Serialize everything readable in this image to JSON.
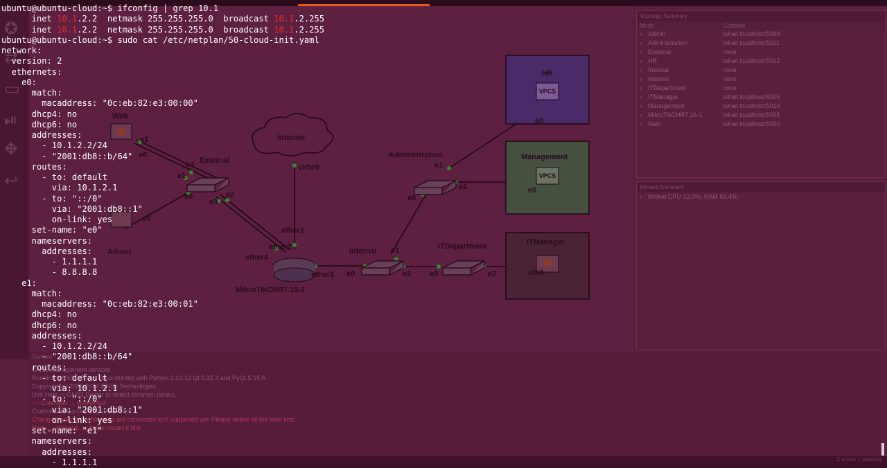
{
  "terminal": {
    "lines": [
      {
        "indent": "",
        "text": "ubuntu@ubuntu-cloud:~$ ifconfig | grep 10.1"
      },
      {
        "indent": "",
        "text": ""
      },
      {
        "indent": "",
        "text": ""
      },
      {
        "indent": "",
        "text": "ubuntu@ubuntu-cloud:~$ sudo cat /etc/netplan/50-cloud-init.yaml"
      },
      {
        "indent": "",
        "text": "network:"
      },
      {
        "indent": "  ",
        "text": "version: 2"
      },
      {
        "indent": "  ",
        "text": "ethernets:"
      },
      {
        "indent": "    ",
        "text": "e0:"
      },
      {
        "indent": "      ",
        "text": "match:"
      },
      {
        "indent": "        ",
        "text": "macaddress: \"0c:eb:82:e3:00:00\""
      },
      {
        "indent": "      ",
        "text": "dhcp4: no"
      },
      {
        "indent": "      ",
        "text": "dhcp6: no"
      },
      {
        "indent": "      ",
        "text": "addresses:"
      },
      {
        "indent": "        ",
        "text": "- 10.1.2.2/24"
      },
      {
        "indent": "        ",
        "text": "- \"2001:db8::b/64\""
      },
      {
        "indent": "      ",
        "text": "routes:"
      },
      {
        "indent": "        ",
        "text": "- to: default"
      },
      {
        "indent": "          ",
        "text": "via: 10.1.2.1"
      },
      {
        "indent": "        ",
        "text": "- to: \"::/0\""
      },
      {
        "indent": "          ",
        "text": "via: \"2001:db8::1\""
      },
      {
        "indent": "          ",
        "text": "on-link: yes"
      },
      {
        "indent": "      ",
        "text": "set-name: \"e0\""
      },
      {
        "indent": "      ",
        "text": "nameservers:"
      },
      {
        "indent": "        ",
        "text": "addresses:"
      },
      {
        "indent": "          ",
        "text": "- 1.1.1.1"
      },
      {
        "indent": "          ",
        "text": "- 8.8.8.8"
      },
      {
        "indent": "    ",
        "text": "e1:"
      },
      {
        "indent": "      ",
        "text": "match:"
      },
      {
        "indent": "        ",
        "text": "macaddress: \"0c:eb:82:e3:00:01\""
      },
      {
        "indent": "      ",
        "text": "dhcp4: no"
      },
      {
        "indent": "      ",
        "text": "dhcp6: no"
      },
      {
        "indent": "      ",
        "text": "addresses:"
      },
      {
        "indent": "        ",
        "text": "- 10.1.2.2/24"
      },
      {
        "indent": "        ",
        "text": "- \"2001:db8::b/64\""
      },
      {
        "indent": "      ",
        "text": "routes:"
      },
      {
        "indent": "        ",
        "text": "- to: default"
      },
      {
        "indent": "          ",
        "text": "via: 10.1.2.1"
      },
      {
        "indent": "        ",
        "text": "- to: \"::/0\""
      },
      {
        "indent": "          ",
        "text": "via: \"2001:db8::1\""
      },
      {
        "indent": "          ",
        "text": "on-link: yes"
      },
      {
        "indent": "      ",
        "text": "set-name: \"e1\""
      },
      {
        "indent": "      ",
        "text": "nameservers:"
      },
      {
        "indent": "        ",
        "text": "addresses:"
      },
      {
        "indent": "          ",
        "text": "- 1.1.1.1"
      }
    ],
    "inet_line": {
      "prefix": "      inet ",
      "ip_match": "10.1",
      "ip_rest": ".2.2  netmask 255.255.255.0  broadcast ",
      "bcast_match": "10.1",
      "bcast_rest": ".2.255"
    },
    "colors": {
      "text": "#ffffff",
      "match": "#ef2929"
    }
  },
  "topology": {
    "nodes": [
      {
        "name": "Web"
      },
      {
        "name": "External"
      },
      {
        "name": "Admin"
      },
      {
        "name": "Internet"
      },
      {
        "name": "MikroTikCHR7.16-1"
      },
      {
        "name": "Internal"
      },
      {
        "name": "Administration"
      },
      {
        "name": "ITDepartment"
      },
      {
        "name": "HR"
      },
      {
        "name": "Management"
      },
      {
        "name": "ITManager"
      }
    ],
    "ports": [
      "e1",
      "e0",
      "e4",
      "e1",
      "e0",
      "e3",
      "e2",
      "e0",
      "virbr0",
      "ether1",
      "ether2",
      "ether4",
      "ether3",
      "e0",
      "e1",
      "e2",
      "e0",
      "e1",
      "e0",
      "e1",
      "e2",
      "e0",
      "e0",
      "e0",
      "eth0"
    ],
    "device_icons": [
      "VPCS",
      "VPCS"
    ]
  },
  "topology_summary": {
    "title": "Topology Summary",
    "columns": [
      "Node",
      "Console"
    ],
    "rows": [
      {
        "node": "Admin",
        "console": "telnet localhost:5009"
      },
      {
        "node": "Administration",
        "console": "telnet localhost:5011"
      },
      {
        "node": "External",
        "console": "none"
      },
      {
        "node": "HR",
        "console": "telnet localhost:5012"
      },
      {
        "node": "Internal",
        "console": "none"
      },
      {
        "node": "Internet",
        "console": "none"
      },
      {
        "node": "ITDepartment",
        "console": "none"
      },
      {
        "node": "ITManager",
        "console": "telnet localhost:5006"
      },
      {
        "node": "Management",
        "console": "telnet localhost:5014"
      },
      {
        "node": "MikroTikCHR7.16-1",
        "console": "telnet localhost:5005"
      },
      {
        "node": "Web",
        "console": "telnet localhost:5000"
      }
    ]
  },
  "servers_summary": {
    "title": "Servers Summary",
    "rows": [
      "lenovo CPU 12.0%, RAM 63.4%"
    ]
  },
  "console": {
    "title": "Console",
    "lines": [
      {
        "text": "GNS3 management console.",
        "error": false
      },
      {
        "text": "Running GNS3 ...50 on Linux (64-bit) with Python 3.10.12 Qt 5.15.3 and PyQt 5.15.6.",
        "error": false
      },
      {
        "text": "Copyright (c) 2006-2024 GNS3 Technologies.",
        "error": false
      },
      {
        "text": "Use Help -> GNS3 Doctor to detect common issues.",
        "error": false
      },
      {
        "text": "=> Controller ... connected",
        "error": true
      },
      {
        "text": "Controller is successfully connected.",
        "error": false
      },
      {
        "text": "Changing adapters while links are connected isn't supported yet! Please delete all the links first.",
        "error": true
      },
      {
        "text": "Node ... stopped ... please restart it first",
        "error": true
      }
    ]
  },
  "status": {
    "text": "2 errors 1 warning"
  }
}
